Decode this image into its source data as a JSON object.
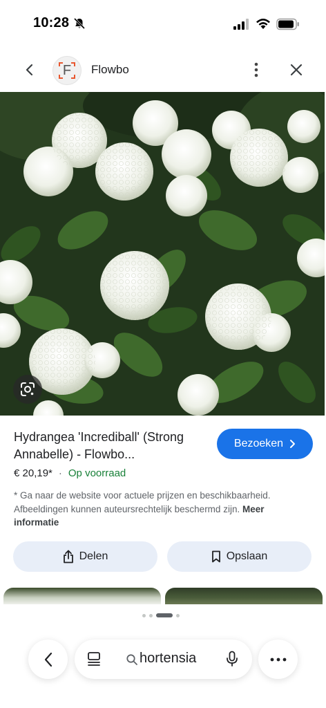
{
  "status_bar": {
    "time": "10:28",
    "icons": [
      "bell-off-icon",
      "signal-icon",
      "wifi-icon",
      "battery-icon"
    ]
  },
  "header": {
    "site_logo_letter": "F",
    "site_name": "Flowbo",
    "icons": [
      "chevron-left-icon",
      "more-vertical-icon",
      "close-icon"
    ]
  },
  "image": {
    "subject": "white hydrangea flowers",
    "lens_icon": "google-lens-icon"
  },
  "product": {
    "title": "Hydrangea 'Incrediball' (Strong Annabelle) - Flowbo...",
    "visit_label": "Bezoeken",
    "price": "€ 20,19*",
    "separator": "·",
    "availability": "Op voorraad",
    "disclaimer": "* Ga naar de website voor actuele prijzen en beschikbaarheid. Afbeeldingen kunnen auteursrechtelijk beschermd zijn.",
    "more_info_label": "Meer informatie"
  },
  "actions": {
    "share_label": "Delen",
    "save_label": "Opslaan"
  },
  "pager": {
    "current_page": 3,
    "visible_dots": 4
  },
  "bottom_bar": {
    "search_query": "hortensia",
    "icons": [
      "chevron-left-icon",
      "tabs-icon",
      "search-icon",
      "microphone-icon",
      "more-horizontal-icon"
    ]
  },
  "colors": {
    "accent": "#1a73e8",
    "in_stock": "#188038",
    "action_button_bg": "#e8eef8"
  }
}
